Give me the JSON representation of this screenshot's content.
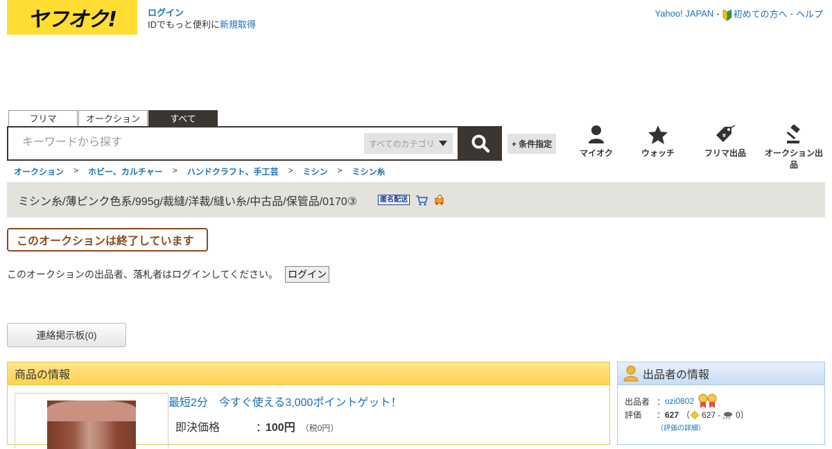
{
  "header": {
    "logo_text": "ヤフオク!",
    "login_link": "ログイン",
    "login_prompt": "IDでもっと便利に",
    "signup_link": "新規取得",
    "top_links": {
      "yahoo_japan": "Yahoo! JAPAN",
      "beginners": "初めての方へ",
      "help": "ヘルプ",
      "separator": "-"
    }
  },
  "search": {
    "tabs": [
      {
        "label": "フリマ",
        "active": false
      },
      {
        "label": "オークション",
        "active": false
      },
      {
        "label": "すべて",
        "active": true
      }
    ],
    "placeholder": "キーワードから探す",
    "category_selected": "すべてのカテゴリ",
    "condition_button": "+ 条件指定"
  },
  "nav": {
    "my_auction": "マイオク",
    "watch": "ウォッチ",
    "flea_listing": "フリマ出品",
    "auction_listing": "オークション出品"
  },
  "breadcrumb": {
    "items": [
      "オークション",
      "ホビー、カルチャー",
      "ハンドクラフト、手工芸",
      "ミシン",
      "ミシン糸"
    ],
    "separator": ">"
  },
  "item": {
    "title": "ミシン糸/薄ピンク色系/995g/裁縫/洋裁/縫い糸/中古品/保管品/0170③",
    "anonymous_badge": "匿名配送",
    "ended_notice": "このオークションは終了しています",
    "login_message": "このオークションの出品者、落札者はログインしてください。",
    "login_button": "ログイン",
    "board_button": "連絡掲示板(0)"
  },
  "product_info": {
    "heading": "商品の情報",
    "promo": "最短2分　今すぐ使える3,000ポイントゲット！",
    "price_label": "即決価格",
    "price_colon": "：",
    "price_value": "100円",
    "price_tax": "（税0円）"
  },
  "seller_info": {
    "heading": "出品者の情報",
    "seller_label": "出品者",
    "seller_colon": "：",
    "seller_id": "ozi0802",
    "rating_label": "評価",
    "rating_colon": "：",
    "rating_total": "627",
    "rating_open": "（",
    "rating_good": "627",
    "rating_dash": "-",
    "rating_bad": "0",
    "rating_close": "）",
    "rating_detail": "（評価の詳細）"
  },
  "colors": {
    "logo_yellow": "#ffdd33",
    "dark_brown": "#3b3631",
    "link_blue": "#1a6fb3",
    "ended_border": "#8a4a1e",
    "product_header": "#ffd24d",
    "seller_header": "#c7dcf3"
  },
  "icons": {
    "search": "search-icon",
    "user": "person-icon",
    "watch": "star-icon",
    "flea": "price-tag-icon",
    "auction": "gavel-icon",
    "cart": "cart-icon",
    "beginner": "beginner-mark-icon"
  }
}
